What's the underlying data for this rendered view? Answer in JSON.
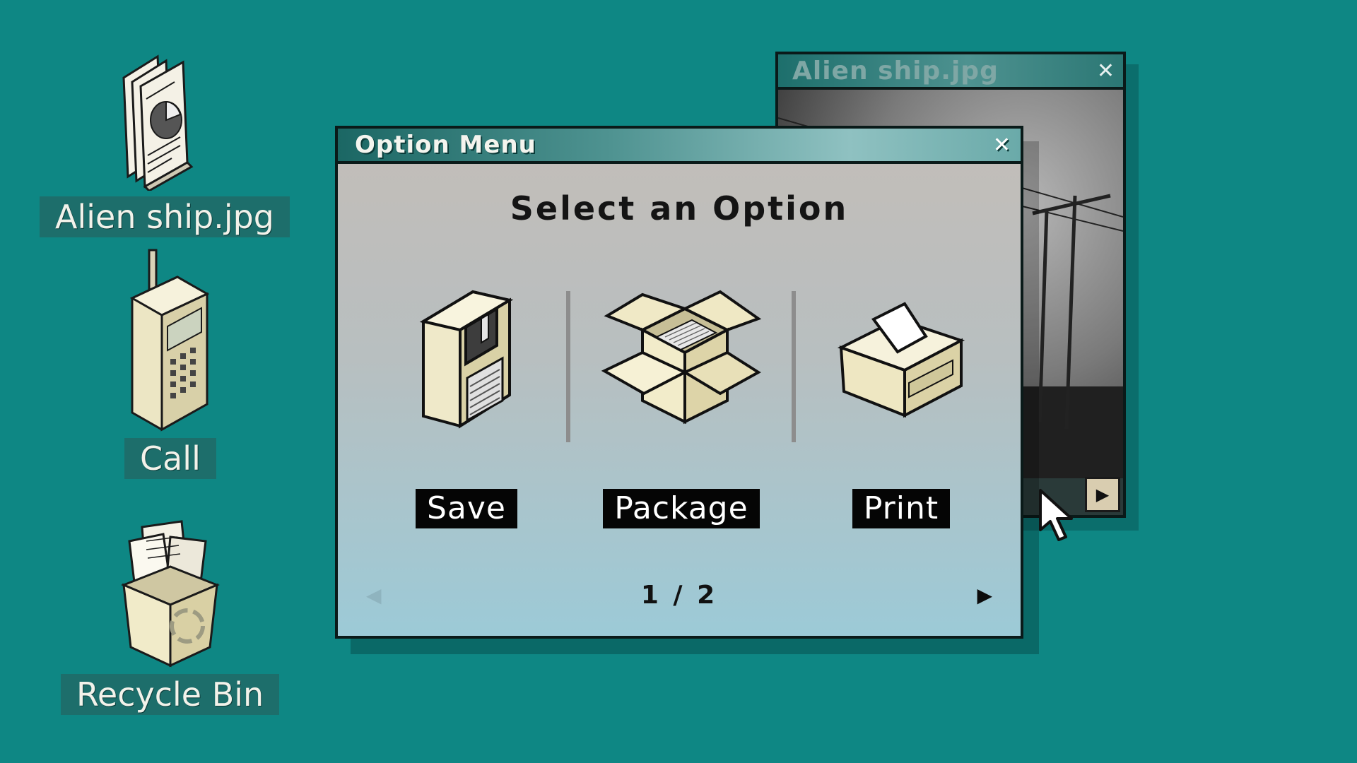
{
  "desktop": {
    "icons": [
      {
        "label": "Alien ship.jpg",
        "icon": "document-chart-icon"
      },
      {
        "label": "Call",
        "icon": "brick-phone-icon"
      },
      {
        "label": "Recycle Bin",
        "icon": "recycle-bin-icon"
      }
    ]
  },
  "image_window": {
    "title": "Alien ship.jpg",
    "close_glyph": "✕",
    "next_glyph": "▶"
  },
  "dialog": {
    "title": "Option Menu",
    "close_glyph": "✕",
    "heading": "Select an Option",
    "options": [
      {
        "label": "Save",
        "icon": "floppy-disk-icon"
      },
      {
        "label": "Package",
        "icon": "open-box-icon"
      },
      {
        "label": "Print",
        "icon": "printer-icon"
      }
    ],
    "pager": {
      "prev_glyph": "◀",
      "page_text": "1 / 2",
      "next_glyph": "▶"
    }
  },
  "colors": {
    "desktop": "#0e8784",
    "titlebar": "#4f9391",
    "button": "#050505"
  }
}
